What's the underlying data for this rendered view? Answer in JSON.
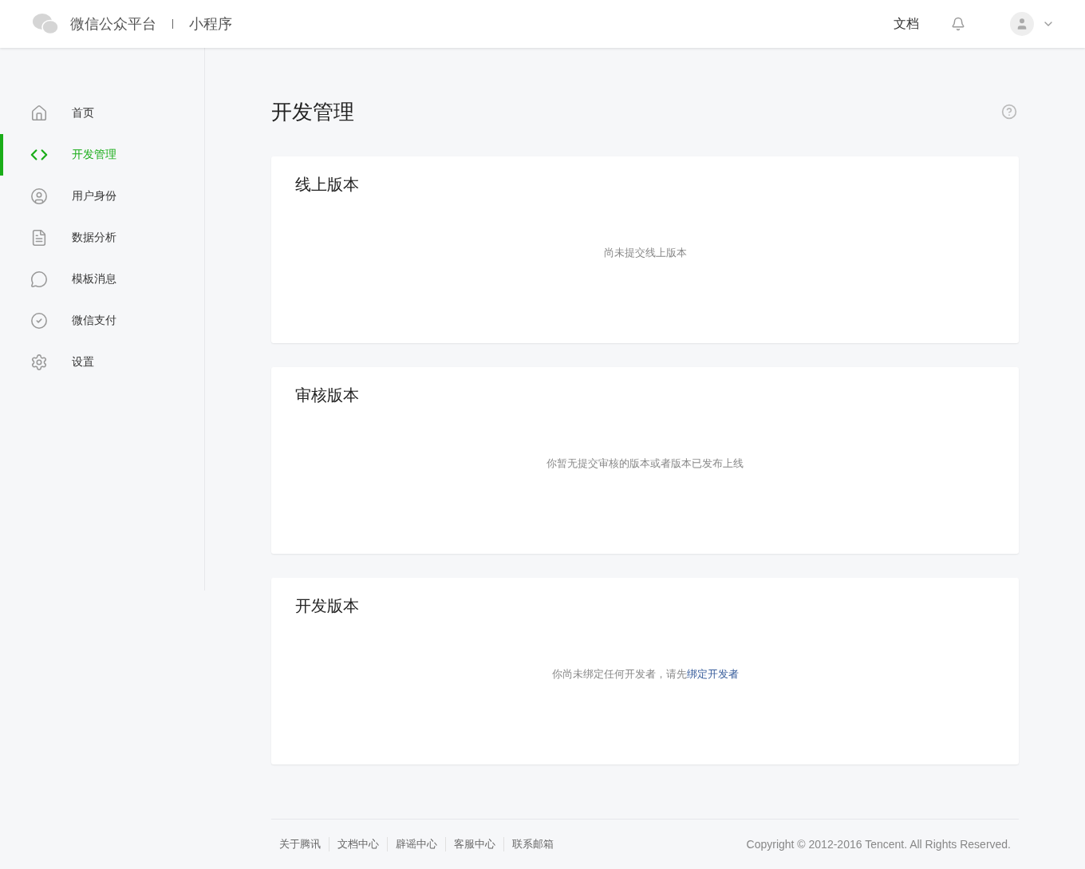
{
  "header": {
    "brand": "微信公众平台",
    "product": "小程序",
    "docs_link": "文档"
  },
  "sidebar": {
    "items": [
      {
        "label": "首页",
        "selected": false
      },
      {
        "label": "开发管理",
        "selected": true
      },
      {
        "label": "用户身份",
        "selected": false
      },
      {
        "label": "数据分析",
        "selected": false
      },
      {
        "label": "模板消息",
        "selected": false
      },
      {
        "label": "微信支付",
        "selected": false
      },
      {
        "label": "设置",
        "selected": false
      }
    ]
  },
  "page": {
    "title": "开发管理"
  },
  "cards": [
    {
      "title": "线上版本",
      "message": "尚未提交线上版本"
    },
    {
      "title": "审核版本",
      "message": "你暂无提交审核的版本或者版本已发布上线"
    },
    {
      "title": "开发版本",
      "message": "你尚未绑定任何开发者，请先",
      "link": "绑定开发者"
    }
  ],
  "footer": {
    "links": [
      "关于腾讯",
      "文档中心",
      "辟谣中心",
      "客服中心",
      "联系邮箱"
    ],
    "copyright": "Copyright © 2012-2016 Tencent. All Rights Reserved."
  }
}
